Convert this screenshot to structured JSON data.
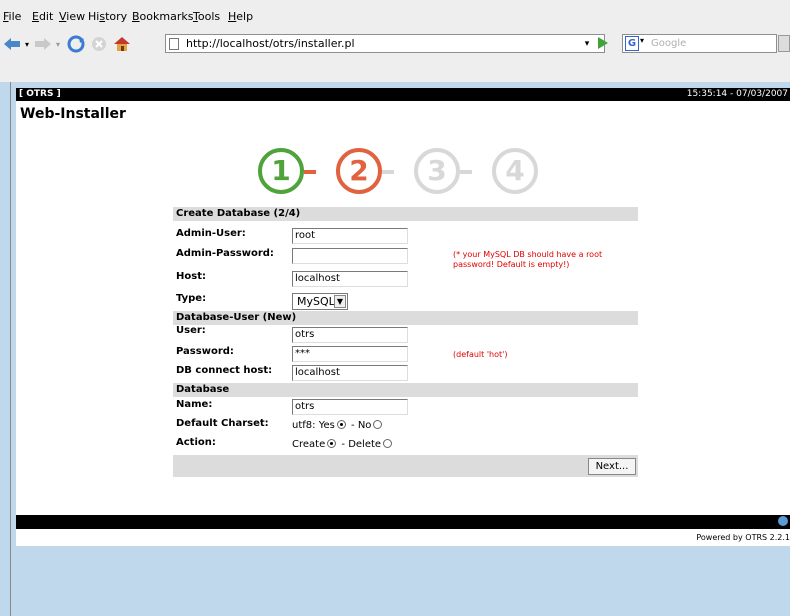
{
  "browser": {
    "menu": [
      "File",
      "Edit",
      "View",
      "History",
      "Bookmarks",
      "Tools",
      "Help"
    ],
    "url": "http://localhost/otrs/installer.pl",
    "search_placeholder": "Google"
  },
  "header": {
    "left": "[ OTRS ]",
    "right": "15:35:14 - 07/03/2007"
  },
  "page_title": "Web-Installer",
  "steps": [
    {
      "num": "1",
      "color": "#4fa33a"
    },
    {
      "num": "2",
      "color": "#e0623e"
    },
    {
      "num": "3",
      "color": "#d8d8d8"
    },
    {
      "num": "4",
      "color": "#d8d8d8"
    }
  ],
  "form": {
    "section_create": "Create Database (2/4)",
    "admin_user_label": "Admin-User:",
    "admin_user_value": "root",
    "admin_password_label": "Admin-Password:",
    "admin_password_value": "",
    "admin_password_hint": "(* your MySQL DB should have a root password! Default is empty!)",
    "host_label": "Host:",
    "host_value": "localhost",
    "type_label": "Type:",
    "type_value": "MySQL",
    "section_dbuser": "Database-User (New)",
    "user_label": "User:",
    "user_value": "otrs",
    "password_label": "Password:",
    "password_value": "***",
    "password_hint": "(default 'hot')",
    "db_connect_host_label": "DB connect host:",
    "db_connect_host_value": "localhost",
    "section_database": "Database",
    "name_label": "Name:",
    "name_value": "otrs",
    "charset_label": "Default Charset:",
    "charset_text_yes": "utf8: Yes",
    "charset_text_no": "- No",
    "action_label": "Action:",
    "action_text_create": "Create",
    "action_text_delete": "- Delete",
    "next_label": "Next..."
  },
  "footer": {
    "powered": "Powered by OTRS 2.2.1"
  }
}
